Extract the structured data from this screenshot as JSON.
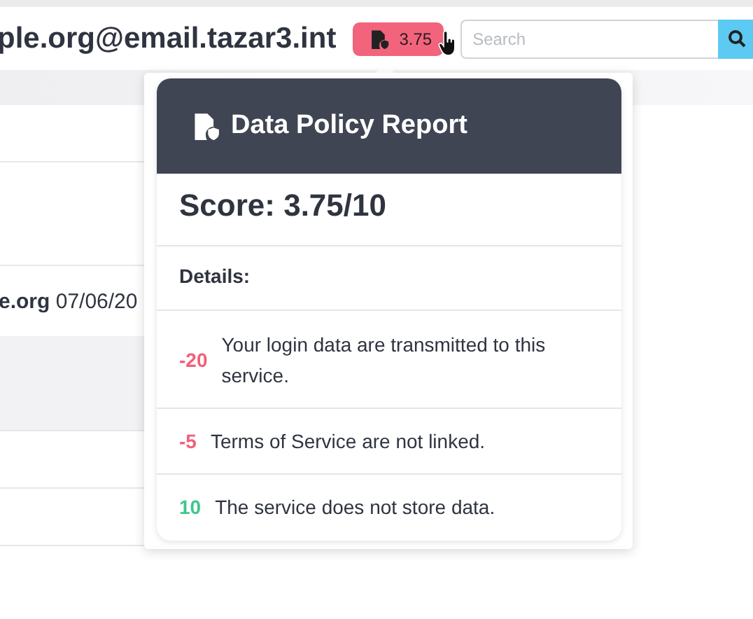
{
  "header": {
    "account": "ple.org@email.tazar3.int",
    "score_badge": "3.75",
    "search": {
      "placeholder": "Search"
    }
  },
  "list": {
    "rows": [
      {
        "kind": "plain",
        "text": ""
      },
      {
        "kind": "plain",
        "text": ""
      },
      {
        "kind": "entry",
        "text": "**e.org** 07/06/20"
      },
      {
        "kind": "shaded",
        "text": ""
      },
      {
        "kind": "plain",
        "text": ""
      },
      {
        "kind": "plain",
        "text": ""
      }
    ]
  },
  "report": {
    "title": "Data Policy Report",
    "score": "Score: 3.75/10",
    "details_label": "Details:",
    "items": [
      {
        "points": "-20",
        "color": "#f0607a",
        "text": "Your login data are transmitted to this service."
      },
      {
        "points": "-5",
        "color": "#f0607a",
        "text": "Terms of Service are not linked."
      },
      {
        "points": "10",
        "color": "#3cc88a",
        "text": "The service does not store data."
      }
    ]
  }
}
